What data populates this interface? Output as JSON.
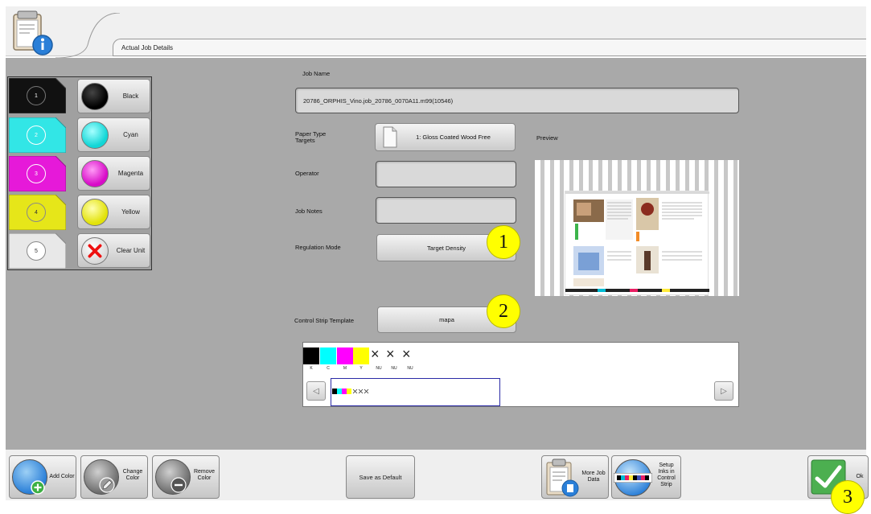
{
  "header": {
    "section_title": "Actual Job Details"
  },
  "units": [
    {
      "number": "1",
      "name": "Black",
      "tab_color": "#111111",
      "dot_color": "#0a0a0a"
    },
    {
      "number": "2",
      "name": "Cyan",
      "tab_color": "#32e6e6",
      "dot_color": "#2de0e0"
    },
    {
      "number": "3",
      "name": "Magenta",
      "tab_color": "#e619d9",
      "dot_color": "#e60fd6"
    },
    {
      "number": "4",
      "name": "Yellow",
      "tab_color": "#e6e619",
      "dot_color": "#eeee10"
    },
    {
      "number": "5",
      "name": "Clear Unit",
      "tab_color": "#e8e8e8",
      "dot_color": "#ffffff"
    }
  ],
  "form": {
    "job_name_label": "Job Name",
    "job_name_value": "20786_ORPHIS_Vino.job_20786_0070A11.m99(10546)",
    "paper_type_label": "Paper Type\nTargets",
    "paper_type_value": "1: Gloss Coated Wood Free",
    "preview_label": "Preview",
    "operator_label": "Operator",
    "operator_value": "",
    "job_notes_label": "Job Notes",
    "job_notes_value": "",
    "regulation_mode_label": "Regulation Mode",
    "regulation_mode_value": "Target Density",
    "control_strip_label": "Control Strip Template",
    "control_strip_value": "mapa"
  },
  "strip": {
    "swatches": [
      {
        "label": "K",
        "color": "#000000"
      },
      {
        "label": "C",
        "color": "#00ffff"
      },
      {
        "label": "M",
        "color": "#ff00ff"
      },
      {
        "label": "Y",
        "color": "#ffff00"
      }
    ],
    "nu_label": "NU",
    "x_glyph": "×"
  },
  "callouts": [
    "1",
    "2",
    "3"
  ],
  "toolbar": {
    "add_color": "Add Color",
    "change_color": "Change\nColor",
    "remove_color": "Remove\nColor",
    "save_default": "Save as Default",
    "more_job_data": "More Job\nData",
    "setup_inks": "Setup\nInks in\nControl\nStrip",
    "ok": "Ok"
  }
}
